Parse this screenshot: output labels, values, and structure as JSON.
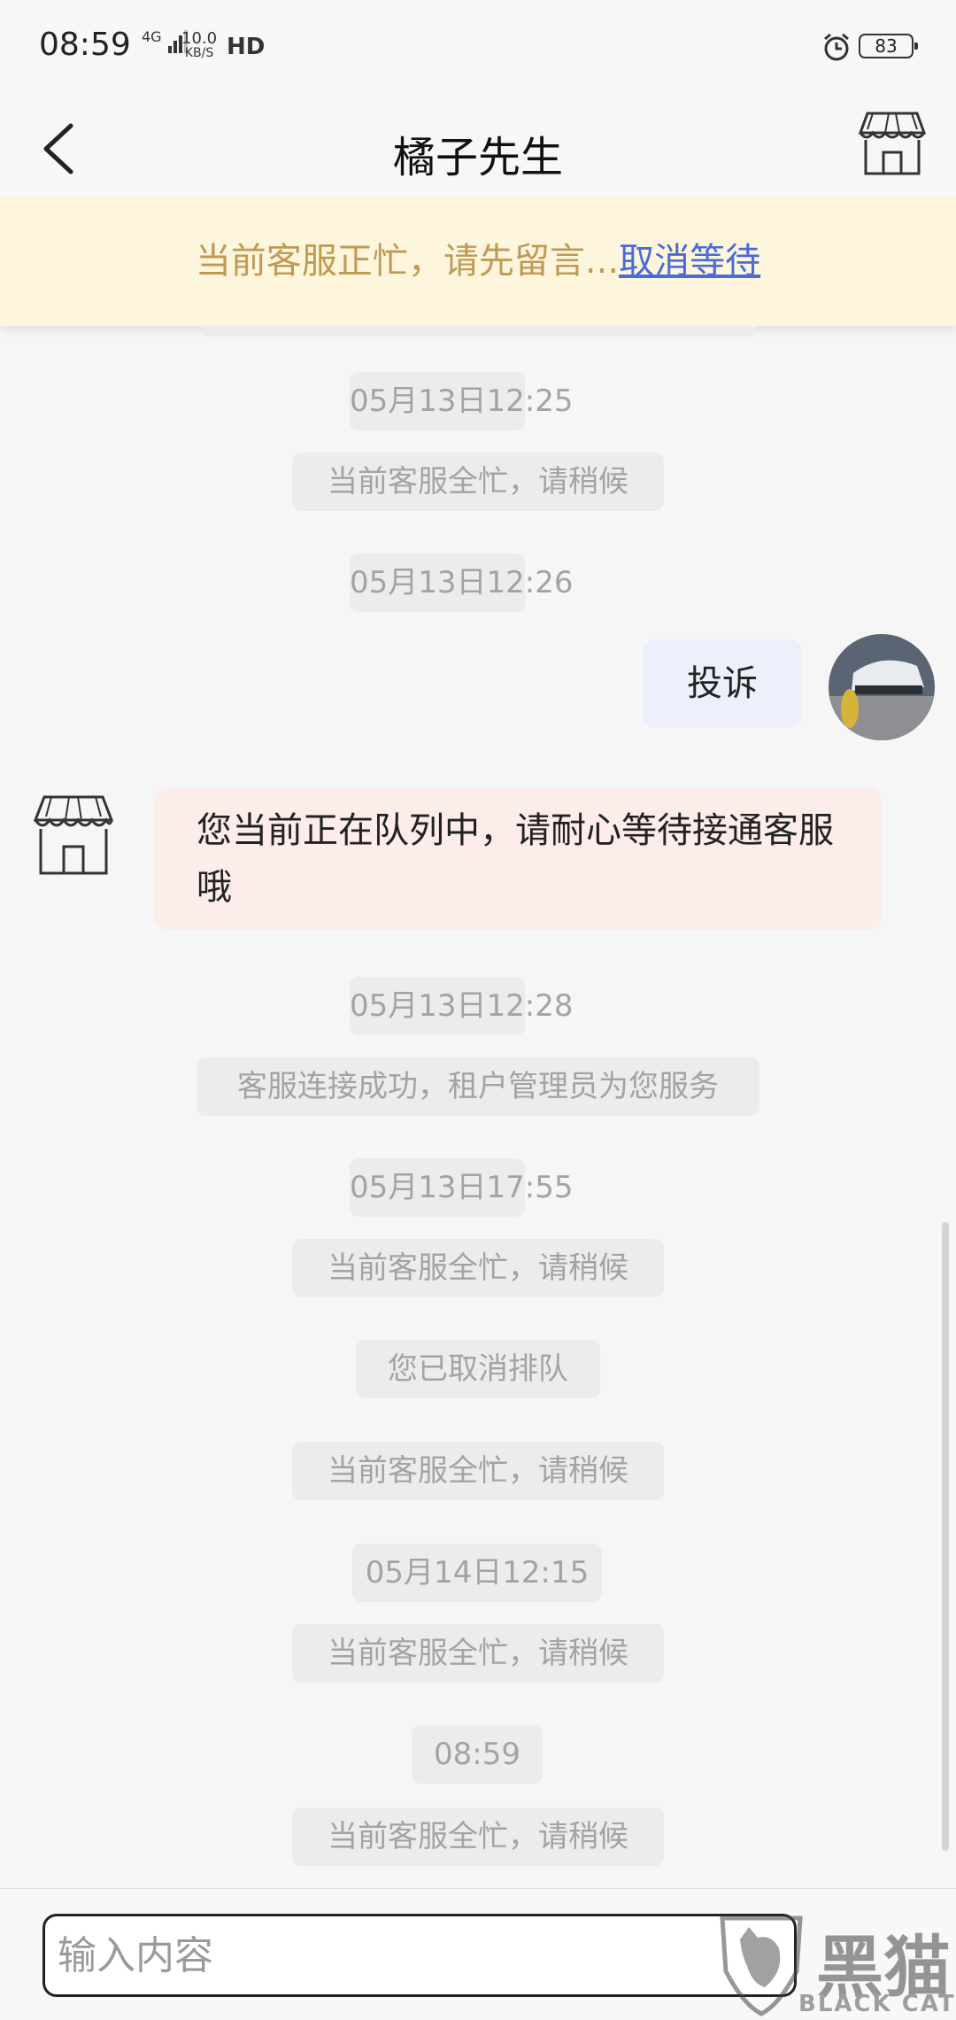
{
  "status_bar": {
    "time": "08:59",
    "network": "4G",
    "speed_value": "10.0",
    "speed_unit": "KB/S",
    "hd": "HD",
    "alarm_icon": "alarm-clock-icon",
    "battery": "83"
  },
  "header": {
    "title": "橘子先生",
    "back_icon": "chevron-left-icon",
    "store_icon": "storefront-icon"
  },
  "notice": {
    "text": "当前客服正忙，请先留言...",
    "link": "取消等待"
  },
  "messages": [
    {
      "type": "time",
      "text": "05月13日12:25"
    },
    {
      "type": "system",
      "text": "当前客服全忙，请稍候"
    },
    {
      "type": "time",
      "text": "05月13日12:26"
    },
    {
      "type": "outgoing",
      "text": "投诉"
    },
    {
      "type": "incoming",
      "text": "您当前正在队列中，请耐心等待接通客服哦"
    },
    {
      "type": "time",
      "text": "05月13日12:28"
    },
    {
      "type": "system",
      "text": "客服连接成功，租户管理员为您服务"
    },
    {
      "type": "time",
      "text": "05月13日17:55"
    },
    {
      "type": "system",
      "text": "当前客服全忙，请稍候"
    },
    {
      "type": "system",
      "text": "您已取消排队"
    },
    {
      "type": "system",
      "text": "当前客服全忙，请稍候"
    },
    {
      "type": "time",
      "text": "05月14日12:15"
    },
    {
      "type": "system",
      "text": "当前客服全忙，请稍候"
    },
    {
      "type": "time",
      "text": "08:59"
    },
    {
      "type": "system",
      "text": "当前客服全忙，请稍候"
    }
  ],
  "input": {
    "placeholder": "输入内容"
  },
  "watermark": {
    "cn": "黑猫",
    "en": "BLACK CAT"
  },
  "colors": {
    "notice_bg": "#fdf6dc",
    "notice_text": "#c09a55",
    "link": "#4a6bd8",
    "outgoing_bubble": "#edf0fb",
    "incoming_bubble": "#fcecea",
    "pill_bg": "#ececec"
  }
}
